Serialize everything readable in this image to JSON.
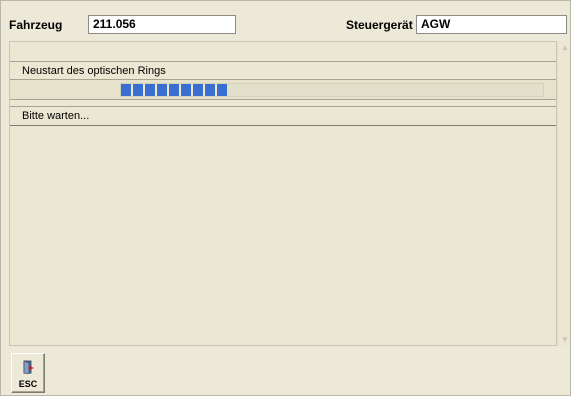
{
  "header": {
    "vehicle_label": "Fahrzeug",
    "vehicle_value": "211.056",
    "ecu_label": "Steuergerät",
    "ecu_value": "AGW"
  },
  "panel": {
    "title": "Neustart des optischen Rings",
    "progress": 0.25,
    "status": "Bitte warten..."
  },
  "toolbar": {
    "esc_label": "ESC",
    "esc_icon": "exit-door-icon"
  },
  "colors": {
    "progress": "#3a6fd2",
    "background": "#ece9d8"
  }
}
